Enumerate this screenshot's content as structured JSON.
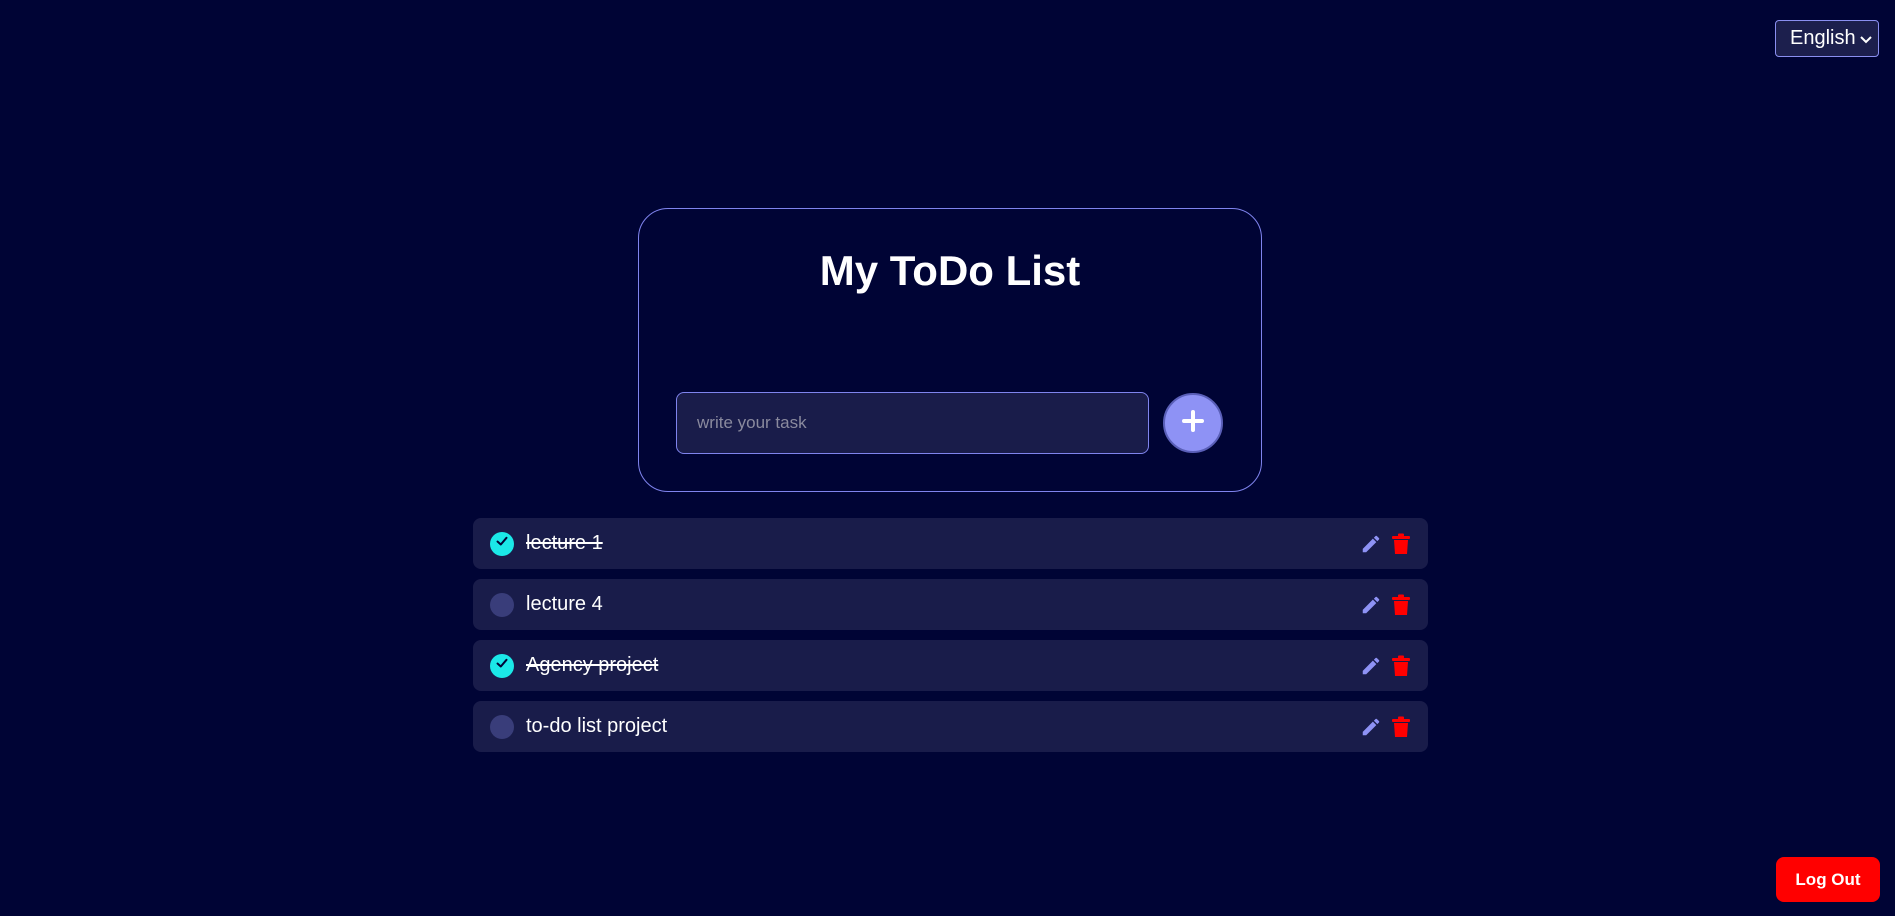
{
  "language": {
    "selected": "English"
  },
  "card": {
    "title": "My ToDo List",
    "input_placeholder": "write your task",
    "input_value": ""
  },
  "todos": [
    {
      "text": "lecture 1",
      "done": true
    },
    {
      "text": "lecture 4",
      "done": false
    },
    {
      "text": "Agency project",
      "done": true
    },
    {
      "text": "to-do list project",
      "done": false
    }
  ],
  "logout_label": "Log Out",
  "colors": {
    "background": "#000435",
    "accent": "#8e92f5",
    "done": "#1be8e8",
    "danger": "#ff0000"
  }
}
